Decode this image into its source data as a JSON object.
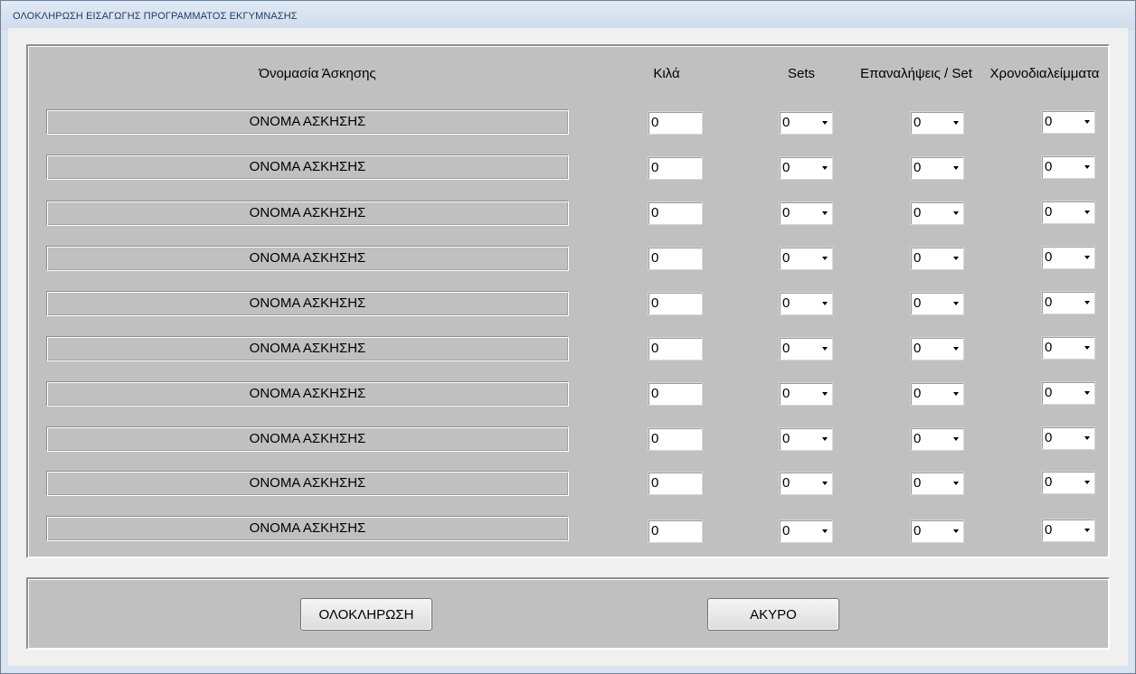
{
  "window": {
    "title": "ΟΛΟΚΛΗΡΩΣΗ ΕΙΣΑΓΩΓΗΣ ΠΡΟΓΡΑΜΜΑΤΟΣ ΕΚΓΥΜΝΑΣΗΣ"
  },
  "headers": {
    "name": "Όνομασία Άσκησης",
    "kila": "Κιλά",
    "sets": "Sets",
    "reps": "Επαναλήψεις / Set",
    "rest": "Χρονοδιαλείμματα"
  },
  "rows": [
    {
      "name": "ΟΝΟΜΑ ΑΣΚΗΣΗΣ",
      "kila": "0",
      "sets": "0",
      "reps": "0",
      "rest": "0"
    },
    {
      "name": "ΟΝΟΜΑ ΑΣΚΗΣΗΣ",
      "kila": "0",
      "sets": "0",
      "reps": "0",
      "rest": "0"
    },
    {
      "name": "ΟΝΟΜΑ ΑΣΚΗΣΗΣ",
      "kila": "0",
      "sets": "0",
      "reps": "0",
      "rest": "0"
    },
    {
      "name": "ΟΝΟΜΑ ΑΣΚΗΣΗΣ",
      "kila": "0",
      "sets": "0",
      "reps": "0",
      "rest": "0"
    },
    {
      "name": "ΟΝΟΜΑ ΑΣΚΗΣΗΣ",
      "kila": "0",
      "sets": "0",
      "reps": "0",
      "rest": "0"
    },
    {
      "name": "ΟΝΟΜΑ ΑΣΚΗΣΗΣ",
      "kila": "0",
      "sets": "0",
      "reps": "0",
      "rest": "0"
    },
    {
      "name": "ΟΝΟΜΑ ΑΣΚΗΣΗΣ",
      "kila": "0",
      "sets": "0",
      "reps": "0",
      "rest": "0"
    },
    {
      "name": "ΟΝΟΜΑ ΑΣΚΗΣΗΣ",
      "kila": "0",
      "sets": "0",
      "reps": "0",
      "rest": "0"
    },
    {
      "name": "ΟΝΟΜΑ ΑΣΚΗΣΗΣ",
      "kila": "0",
      "sets": "0",
      "reps": "0",
      "rest": "0"
    },
    {
      "name": "ΟΝΟΜΑ ΑΣΚΗΣΗΣ",
      "kila": "0",
      "sets": "0",
      "reps": "0",
      "rest": "0"
    }
  ],
  "buttons": {
    "complete": "ΟΛΟΚΛΗΡΩΣΗ",
    "cancel": "ΑΚΥΡΟ"
  }
}
